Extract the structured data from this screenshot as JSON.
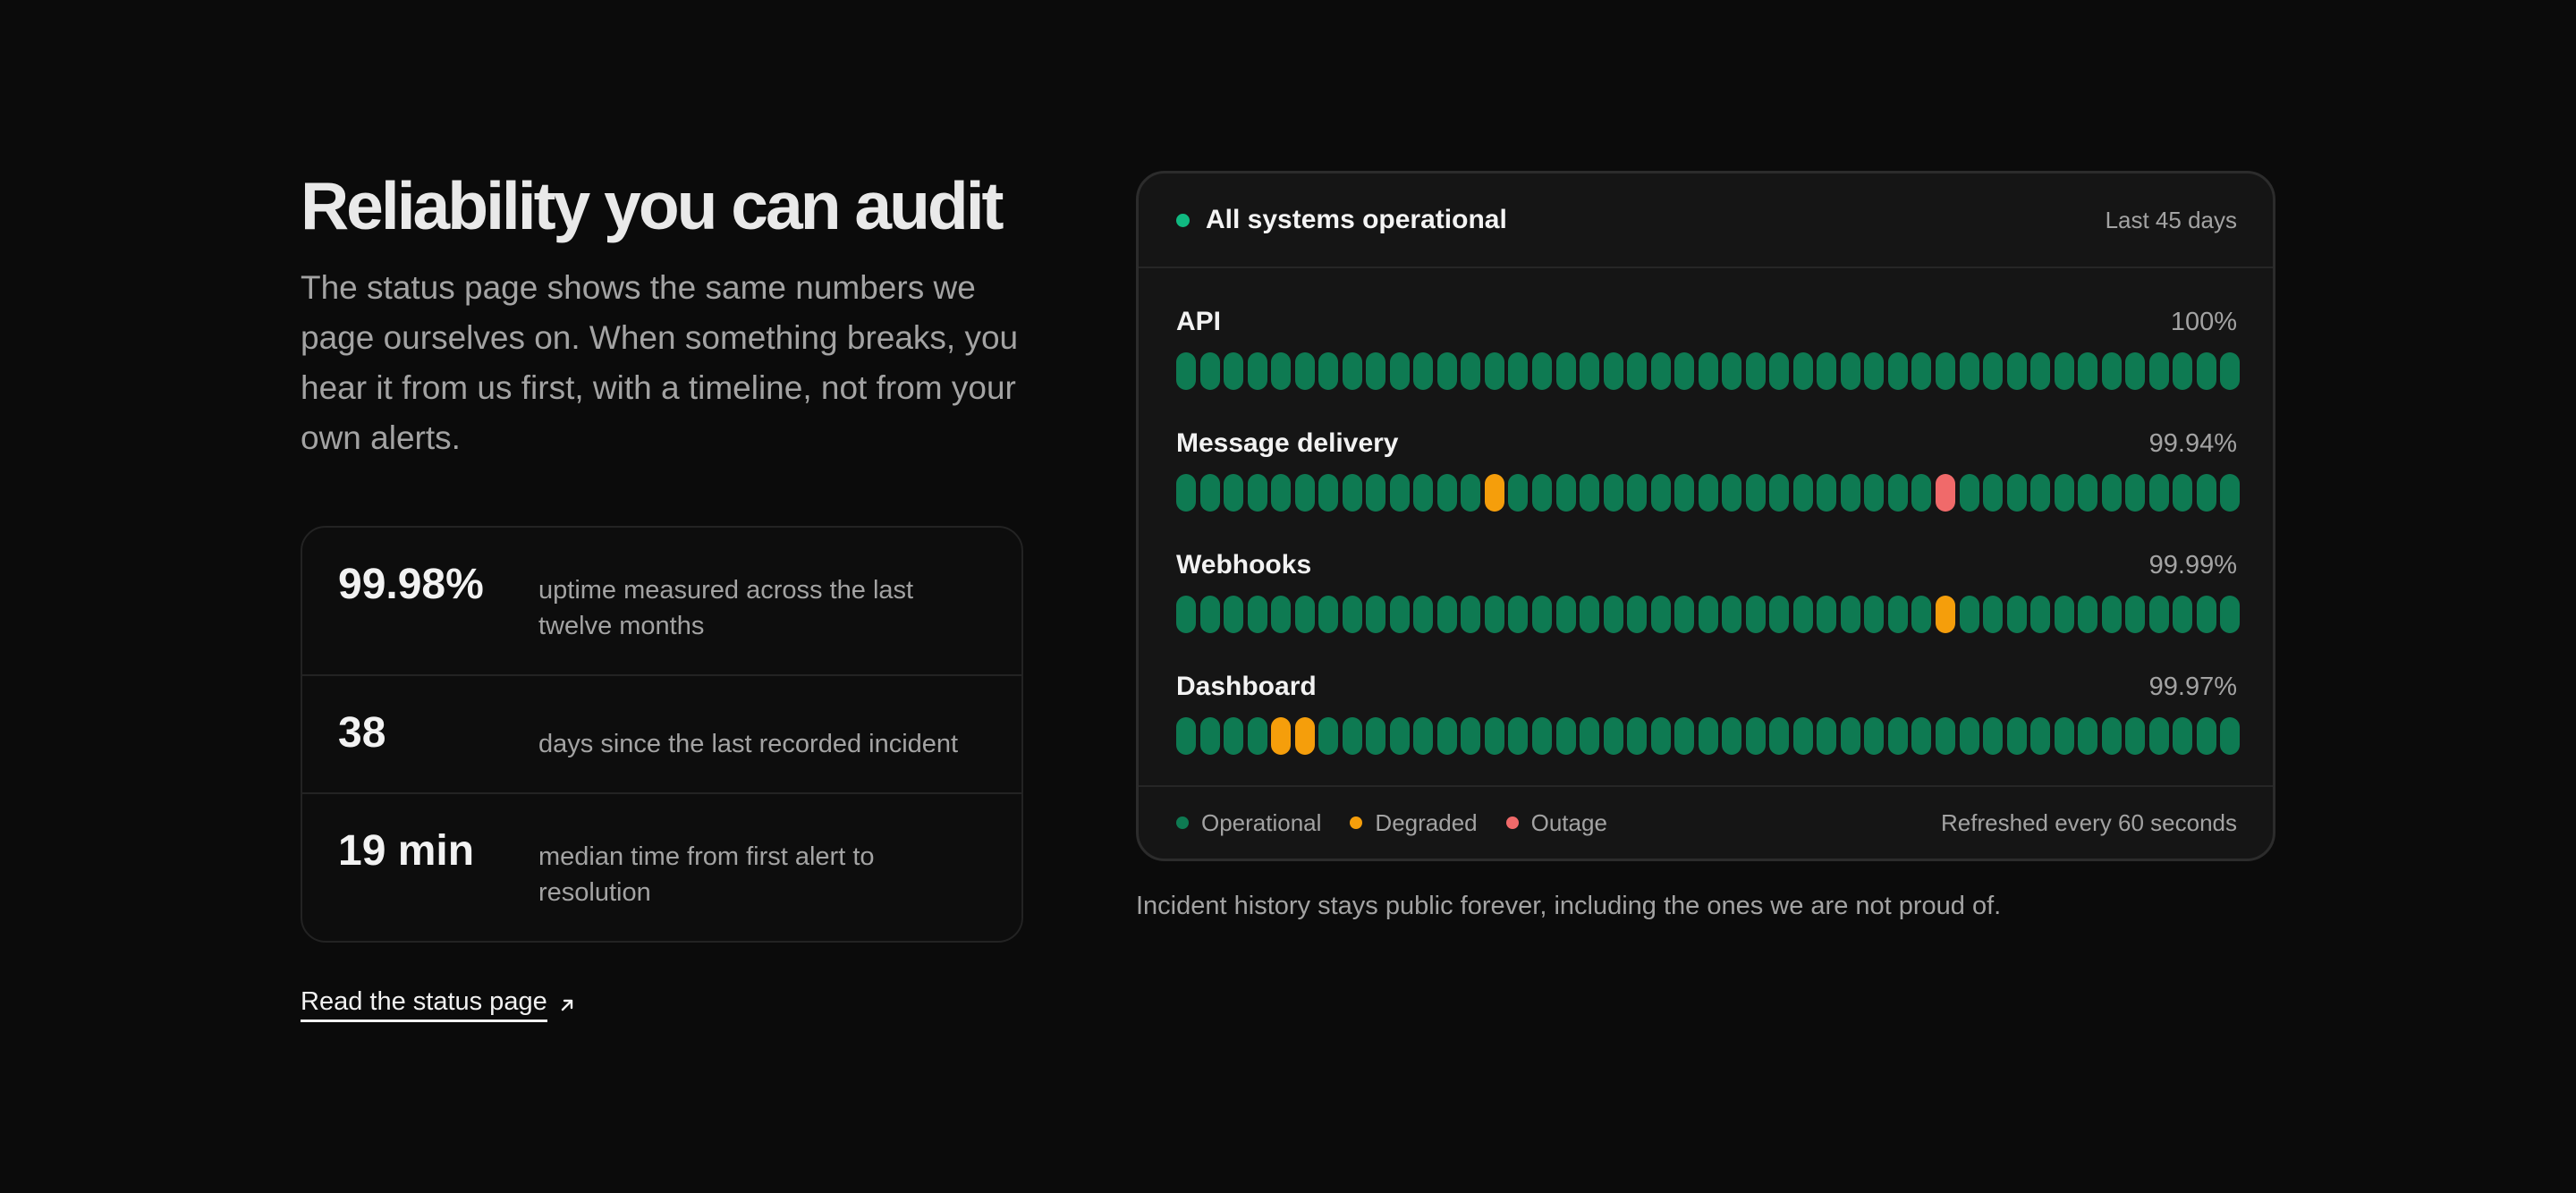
{
  "headline": "Reliability you can audit",
  "lede": "The status page shows the same numbers we page ourselves on. When something breaks, you hear it from us first, with a timeline, not from your own alerts.",
  "stats": [
    {
      "value": "99.98%",
      "description": "uptime measured across the last twelve months"
    },
    {
      "value": "38",
      "description": "days since the last recorded incident"
    },
    {
      "value": "19 min",
      "description": "median time from first alert to resolution"
    }
  ],
  "cta": {
    "label": "Read the status page",
    "icon": "arrow-up-right-icon"
  },
  "status_card": {
    "overall_status": "All systems operational",
    "range": "Last 45 days",
    "colors": {
      "operational": "#0e7a52",
      "degraded": "#f59e0b",
      "outage": "#f06a6a",
      "status_dot": "#10b981"
    },
    "services": [
      {
        "name": "API",
        "uptime": "100%",
        "days": "ooooooooooooooooooooooooooooooooooooooooooooo"
      },
      {
        "name": "Message delivery",
        "uptime": "99.94%",
        "days": "ooooooooooooodooooooooooooooooooxoooooooooooo"
      },
      {
        "name": "Webhooks",
        "uptime": "99.99%",
        "days": "oooooooooooooooooooooooooooooooodoooooooooooo"
      },
      {
        "name": "Dashboard",
        "uptime": "99.97%",
        "days": "ooooddooooooooooooooooooooooooooooooooooooooo"
      }
    ],
    "legend": [
      {
        "label": "Operational",
        "key": "op"
      },
      {
        "label": "Degraded",
        "key": "deg"
      },
      {
        "label": "Outage",
        "key": "out"
      }
    ],
    "refresh_note": "Refreshed every 60 seconds"
  },
  "footnote": "Incident history stays public forever, including the ones we are not proud of."
}
